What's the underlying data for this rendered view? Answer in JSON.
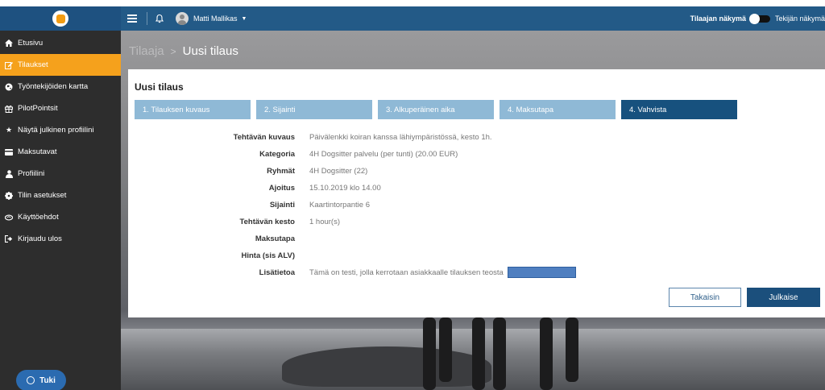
{
  "topbar": {
    "user_name": "Matti Mallikas",
    "view_active": "Tilaajan näkymä",
    "view_other": "Tekijän näkymä"
  },
  "sidebar": {
    "items": [
      {
        "label": "Etusivu",
        "icon": "home-icon"
      },
      {
        "label": "Tilaukset",
        "icon": "edit-icon",
        "active": true
      },
      {
        "label": "Työntekijöiden kartta",
        "icon": "globe-icon"
      },
      {
        "label": "PilotPointsit",
        "icon": "gift-icon"
      },
      {
        "label": "Näytä julkinen profiilini",
        "icon": "star-icon"
      },
      {
        "label": "Maksutavat",
        "icon": "credit-card-icon"
      },
      {
        "label": "Profiilini",
        "icon": "user-icon"
      },
      {
        "label": "Tilin asetukset",
        "icon": "cog-icon"
      },
      {
        "label": "Käyttöehdot",
        "icon": "handshake-icon"
      },
      {
        "label": "Kirjaudu ulos",
        "icon": "sign-out-icon"
      }
    ],
    "support_label": "Tuki"
  },
  "breadcrumb": {
    "parent": "Tilaaja",
    "current": "Uusi tilaus"
  },
  "card": {
    "title": "Uusi tilaus",
    "steps": [
      {
        "label": "1. Tilauksen kuvaus"
      },
      {
        "label": "2. Sijainti"
      },
      {
        "label": "3. Alkuperäinen aika"
      },
      {
        "label": "4. Maksutapa"
      },
      {
        "label": "4. Vahvista",
        "active": true
      }
    ],
    "details": [
      {
        "label": "Tehtävän kuvaus",
        "value": "Päivälenkki koiran kanssa lähiympäristössä, kesto 1h."
      },
      {
        "label": "Kategoria",
        "value": "4H Dogsitter palvelu (per tunti) (20.00 EUR)"
      },
      {
        "label": "Ryhmät",
        "value": "4H Dogsitter (22)"
      },
      {
        "label": "Ajoitus",
        "value": "15.10.2019 klo 14.00"
      },
      {
        "label": "Sijainti",
        "value": "Kaartintorpantie 6"
      },
      {
        "label": "Tehtävän kesto",
        "value": "1 hour(s)"
      },
      {
        "label": "Maksutapa",
        "value": ""
      },
      {
        "label": "Hinta (sis ALV)",
        "value": ""
      },
      {
        "label": "Lisätietoa",
        "value": "Tämä on testi, jolla kerrotaan asiakkaalle tilauksen teosta"
      }
    ],
    "back_label": "Takaisin",
    "publish_label": "Julkaise"
  }
}
